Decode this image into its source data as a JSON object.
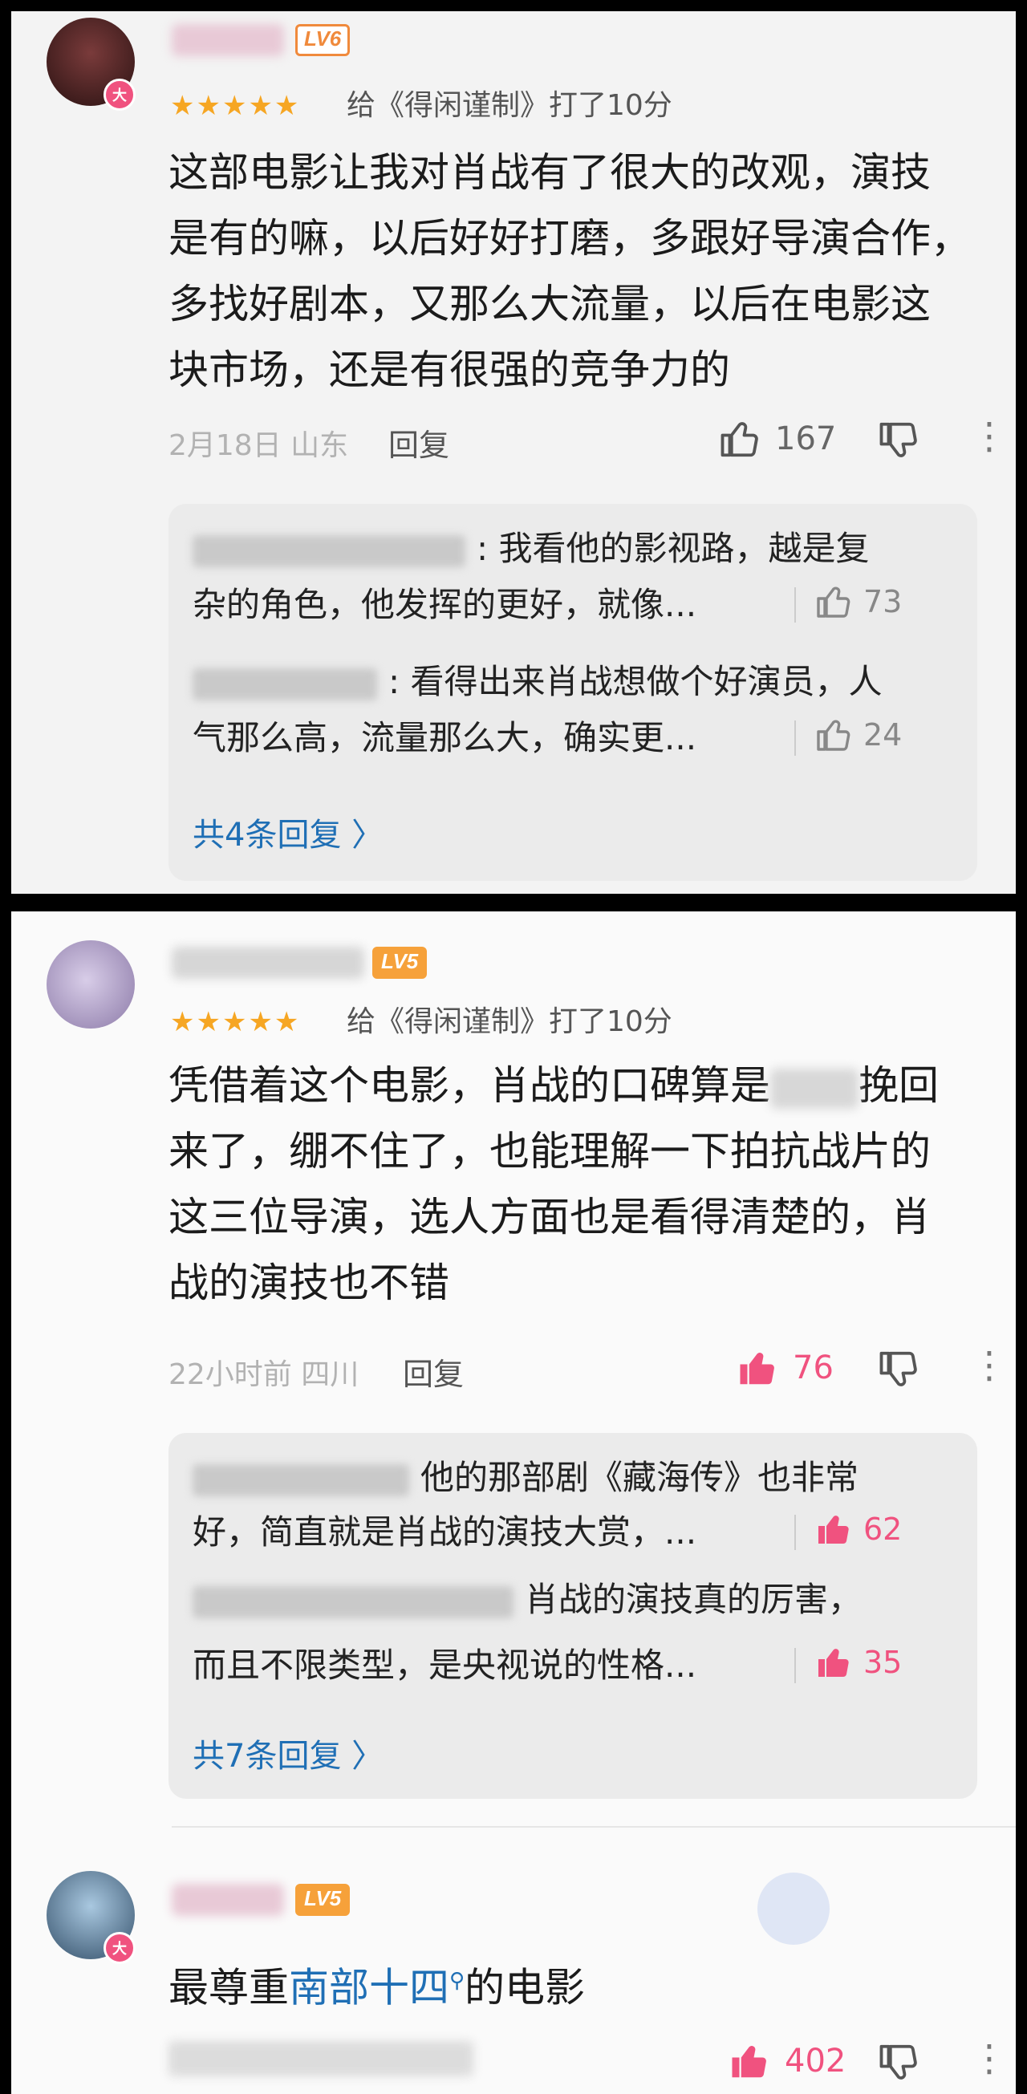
{
  "comments": [
    {
      "level": "LV6",
      "rating_text": "给《得闲谨制》打了10分",
      "badge": "大",
      "body": [
        "这部电影让我对肖战有了很大的改观，演技",
        "是有的嘛，以后好好打磨，多跟好导演合作，",
        "多找好剧本，又那么大流量，以后在电影这",
        "块市场，还是有很强的竞争力的"
      ],
      "date": "2月18日 山东",
      "reply_label": "回复",
      "likes": "167",
      "sub_replies": [
        {
          "lines": [
            ": 我看他的影视路，越是复",
            "杂的角色，他发挥的更好，就像..."
          ],
          "likes": "73"
        },
        {
          "lines": ": 看得出来肖战想做个好演员，人",
          "lines2": "气那么高，流量那么大，确实更...",
          "likes": "24"
        }
      ],
      "more_replies": "共4条回复 〉"
    },
    {
      "level": "LV5",
      "rating_text": "给《得闲谨制》打了10分",
      "body_a": "凭借着这个电影，肖战的口碑算是",
      "body_b": "挽回",
      "body": [
        "来了，绷不住了，也能理解一下拍抗战片的",
        "这三位导演，选人方面也是看得清楚的，肖",
        "战的演技也不错"
      ],
      "date": "22小时前 四川",
      "reply_label": "回复",
      "likes": "76",
      "sub_replies": [
        {
          "line1": "他的那部剧《藏海传》也非常",
          "line2": "好，简直就是肖战的演技大赏，...",
          "likes": "62"
        },
        {
          "line1": "肖战的演技真的厉害，",
          "line2": "而且不限类型，是央视说的性格...",
          "likes": "35"
        }
      ],
      "more_replies": "共7条回复 〉"
    },
    {
      "level": "LV5",
      "badge": "大",
      "body_a": "最尊重",
      "body_link": "南部十四",
      "body_b": "的电影",
      "likes": "402"
    }
  ],
  "icons": {
    "thumb_up": "thumb-up-icon",
    "thumb_down": "thumb-down-icon",
    "more": "more-icon",
    "search": "search-icon",
    "star": "star-icon"
  },
  "colors": {
    "accent_pink": "#f0527f",
    "link_blue": "#1f6fb5",
    "star": "#f6a623"
  }
}
